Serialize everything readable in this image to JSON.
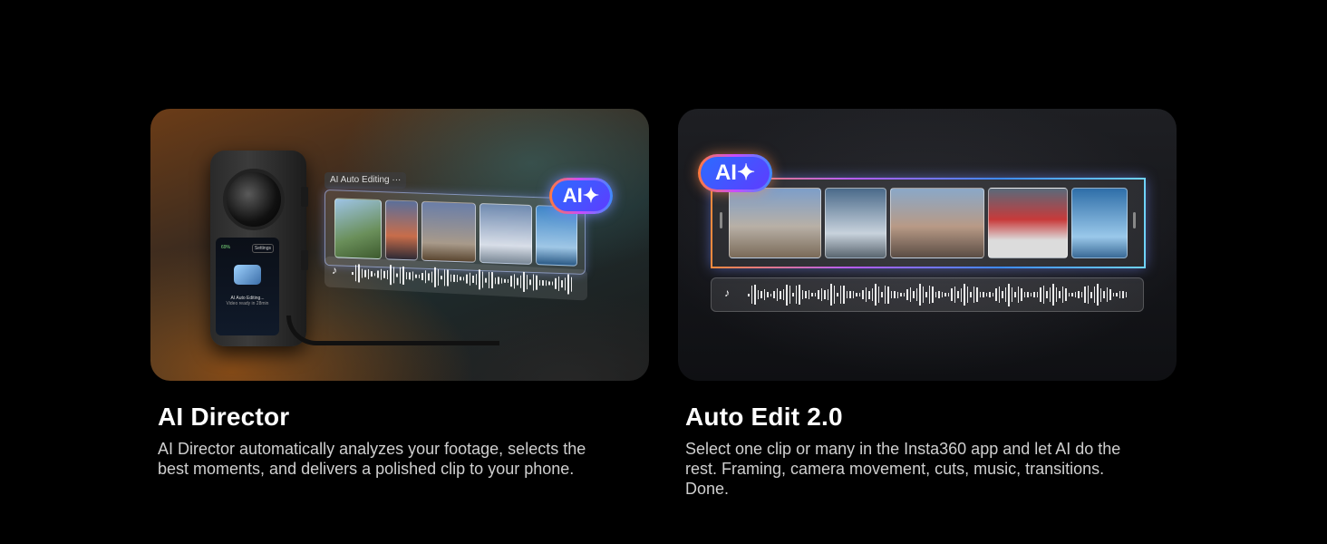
{
  "features": [
    {
      "title": "AI Director",
      "description": "AI Director automatically analyzes your footage, selects the best moments, and delivers a polished clip to your phone.",
      "visual": {
        "editing_label": "AI Auto Editing ···",
        "badge": "AI✦",
        "camera_screen": {
          "battery": "69%",
          "settings": "Settings",
          "status": "AI Auto Editing...",
          "substatus": "Video ready in 28min"
        }
      }
    },
    {
      "title": "Auto Edit 2.0",
      "description": "Select one clip or many in the Insta360 app and let AI do the rest. Framing, camera movement, cuts, music, transitions. Done.",
      "visual": {
        "badge": "AI✦"
      }
    }
  ],
  "icons": {
    "music_note": "♪"
  },
  "colors": {
    "background": "#000000",
    "title": "#ffffff",
    "description": "#cfcfcf",
    "accent_orange": "#ff7a3c",
    "accent_purple": "#c84cff",
    "accent_blue": "#3d8bff"
  }
}
